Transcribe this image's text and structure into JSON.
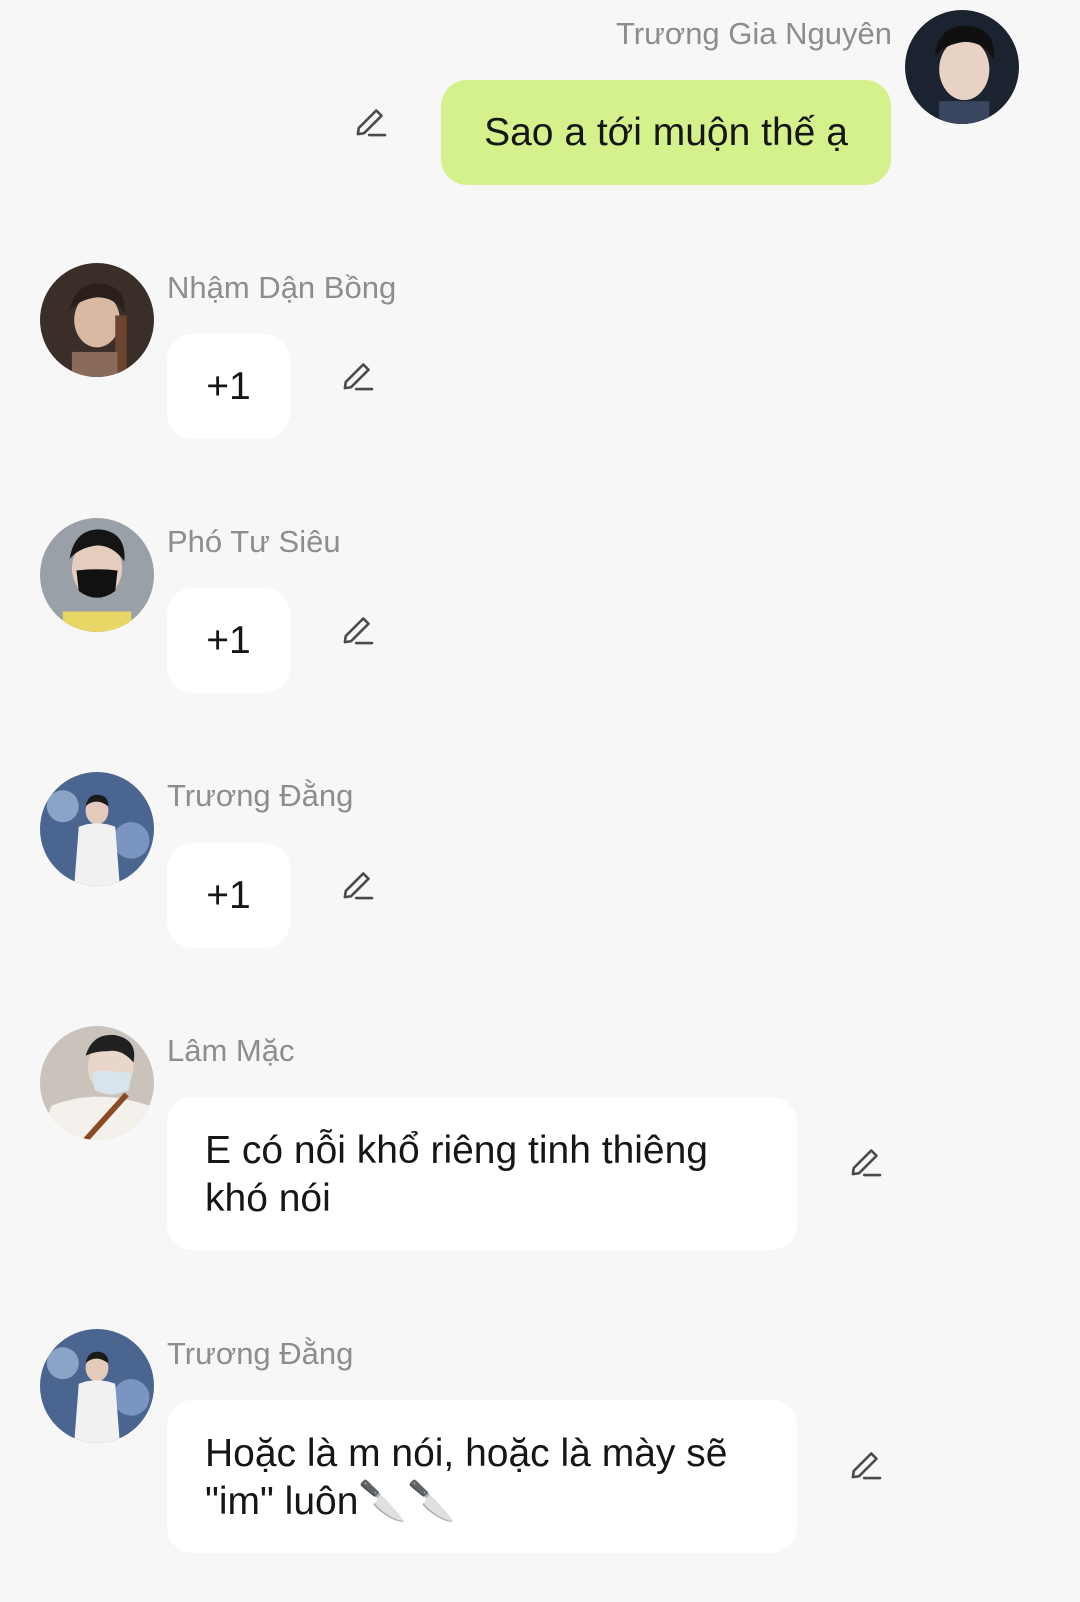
{
  "colors": {
    "background": "#f7f7f7",
    "my_bubble": "#d5f18c",
    "other_bubble": "#ffffff",
    "name_text": "#8d8d8d"
  },
  "messages": [
    {
      "sender": "Trương Gia Nguyên",
      "text": "Sao a tới muộn thế ạ",
      "outgoing": true,
      "edit_icon": "pencil-icon"
    },
    {
      "sender": "Nhậm Dận Bồng",
      "text": "+1",
      "outgoing": false,
      "edit_icon": "pencil-icon"
    },
    {
      "sender": "Phó Tư Siêu",
      "text": "+1",
      "outgoing": false,
      "edit_icon": "pencil-icon"
    },
    {
      "sender": "Trương Đằng",
      "text": "+1",
      "outgoing": false,
      "edit_icon": "pencil-icon"
    },
    {
      "sender": "Lâm Mặc",
      "text": "E có nỗi khổ riêng tinh thiêng khó nói",
      "outgoing": false,
      "edit_icon": "pencil-icon"
    },
    {
      "sender": "Trương Đằng",
      "text": "Hoặc là m nói, hoặc là mày sẽ \"im\" luôn🔪🔪",
      "outgoing": false,
      "edit_icon": "pencil-icon"
    }
  ]
}
